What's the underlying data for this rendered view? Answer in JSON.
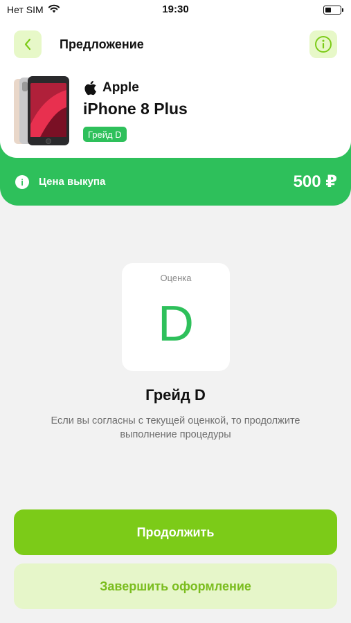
{
  "status_bar": {
    "carrier": "Нет SIM",
    "time": "19:30",
    "icons": [
      "wifi-icon",
      "battery-icon"
    ]
  },
  "header": {
    "title": "Предложение",
    "back_icon": "chevron-left-icon",
    "info_icon": "info-icon"
  },
  "product": {
    "brand": "Apple",
    "brand_icon": "apple-logo-icon",
    "model": "iPhone 8 Plus",
    "grade_badge": "Грейд D"
  },
  "price": {
    "label": "Цена выкупа",
    "value": "500 ₽"
  },
  "grade_card": {
    "label": "Оценка",
    "letter": "D"
  },
  "grade_info": {
    "title": "Грейд D",
    "description": "Если вы согласны с текущей оценкой, то продолжите выполнение процедуры"
  },
  "actions": {
    "continue_label": "Продолжить",
    "finish_label": "Завершить оформление"
  },
  "colors": {
    "accent_green": "#2ec05b",
    "button_green": "#7ccb18",
    "button_light": "#e6f6c9"
  }
}
